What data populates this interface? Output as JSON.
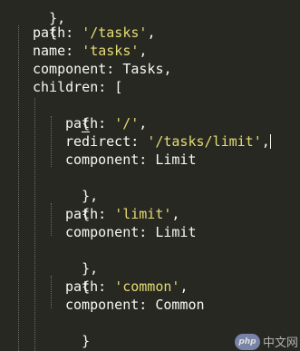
{
  "editor": {
    "background": "#272822",
    "string_color": "#e6db74",
    "text_color": "#f8f8f2",
    "lines": {
      "l0": "},",
      "l1": "{",
      "l2_key": "path",
      "l2_val": "'/tasks'",
      "l3_key": "name",
      "l3_val": "'tasks'",
      "l4_key": "component",
      "l4_val": "Tasks",
      "l5_key": "children",
      "l5_open": "[",
      "l6": "{",
      "l7_key": "path",
      "l7_val": "'/'",
      "l8_key": "redirect",
      "l8_val": "'/tasks/limit'",
      "l9_key": "component",
      "l9_val": "Limit",
      "l10": "},",
      "l11": "{",
      "l12_key": "path",
      "l12_val": "'limit'",
      "l13_key": "component",
      "l13_val": "Limit",
      "l14": "},",
      "l15": "{",
      "l16_key": "path",
      "l16_val": "'common'",
      "l17_key": "component",
      "l17_val": "Common",
      "l18": "}",
      "l19": "]"
    }
  },
  "watermark": {
    "logo": "php",
    "text": "中文网"
  }
}
